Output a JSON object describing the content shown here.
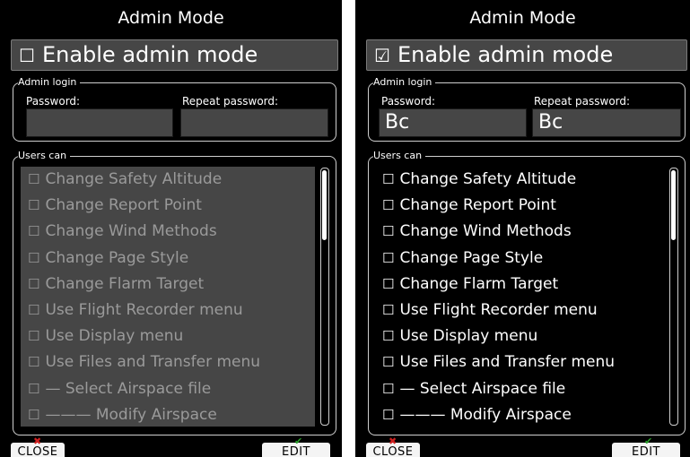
{
  "screens": [
    {
      "title": "Admin Mode",
      "enable_checkbox": "☐",
      "enable_label": "Enable admin mode",
      "admin_group_legend": "Admin login",
      "password_label": "Password:",
      "repeat_password_label": "Repeat password:",
      "password_value": "",
      "repeat_password_value": "",
      "users_group_legend": "Users can",
      "items": [
        {
          "check": "☐",
          "label": "Change Safety Altitude"
        },
        {
          "check": "☐",
          "label": "Change Report Point"
        },
        {
          "check": "☐",
          "label": "Change Wind Methods"
        },
        {
          "check": "☐",
          "label": "Change Page Style"
        },
        {
          "check": "☐",
          "label": "Change Flarm Target"
        },
        {
          "check": "☐",
          "label": "Use Flight Recorder menu"
        },
        {
          "check": "☐",
          "label": "Use Display menu"
        },
        {
          "check": "☐",
          "label": "Use Files and Transfer menu"
        },
        {
          "check": "☐",
          "label": "— Select Airspace file"
        },
        {
          "check": "☐",
          "label": "——— Modify Airspace"
        }
      ],
      "close_label": "CLOSE",
      "edit_label": "EDIT"
    },
    {
      "title": "Admin Mode",
      "enable_checkbox": "☑",
      "enable_label": "Enable admin mode",
      "admin_group_legend": "Admin login",
      "password_label": "Password:",
      "repeat_password_label": "Repeat password:",
      "password_value": "Bc",
      "repeat_password_value": "Bc",
      "users_group_legend": "Users can",
      "items": [
        {
          "check": "☐",
          "label": "Change Safety Altitude"
        },
        {
          "check": "☐",
          "label": "Change Report Point"
        },
        {
          "check": "☐",
          "label": "Change Wind Methods"
        },
        {
          "check": "☐",
          "label": "Change Page Style"
        },
        {
          "check": "☐",
          "label": "Change Flarm Target"
        },
        {
          "check": "☐",
          "label": "Use Flight Recorder menu"
        },
        {
          "check": "☐",
          "label": "Use Display menu"
        },
        {
          "check": "☐",
          "label": "Use Files and Transfer menu"
        },
        {
          "check": "☐",
          "label": "— Select Airspace file"
        },
        {
          "check": "☐",
          "label": "——— Modify Airspace"
        }
      ],
      "close_label": "CLOSE",
      "edit_label": "EDIT"
    }
  ],
  "colors": {
    "screen_bg": "#000000",
    "field_bg": "#464646",
    "disabled_text": "#9a9a9a",
    "close_mark": "#d12020",
    "edit_mark": "#2aa32a"
  },
  "icons": {
    "close_mark": "✖",
    "edit_mark": "✔"
  }
}
